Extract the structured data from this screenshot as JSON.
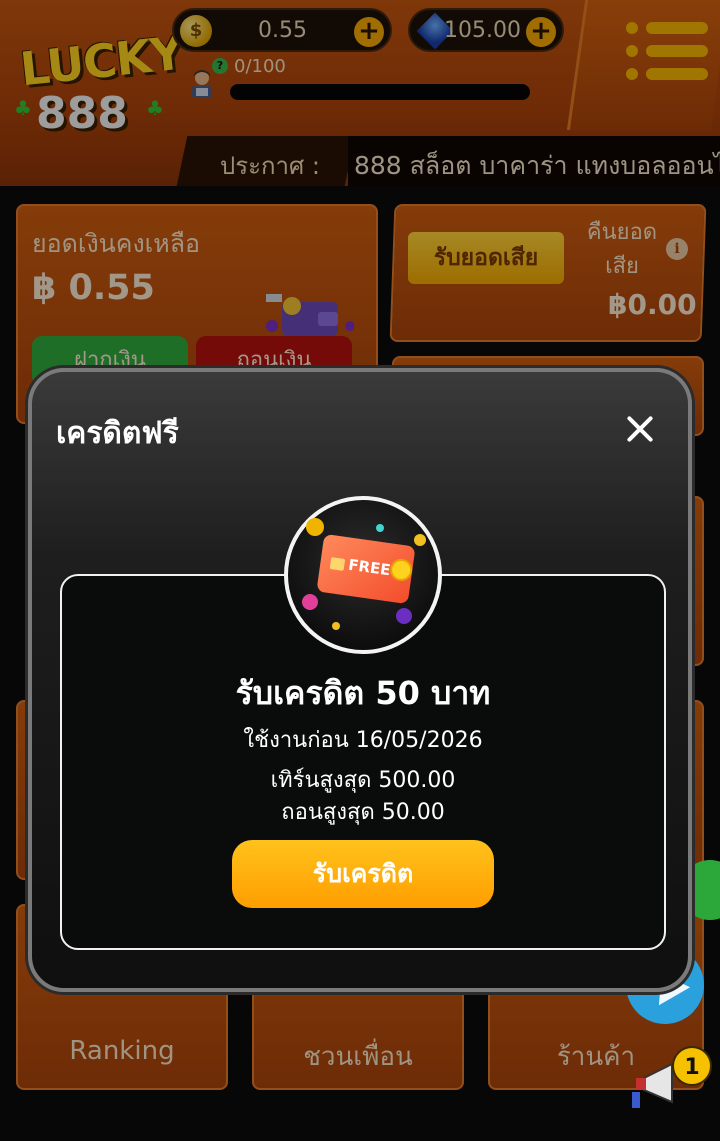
{
  "header": {
    "logo_text": "LUCKY 888",
    "coin_balance": "0.55",
    "gem_balance": "105.00",
    "xp_text": "0/100",
    "xp_progress": 0,
    "announcement_label": "ประกาศ :",
    "announcement_text": "888 สล็อต บาคาร่า แทงบอลออนไ"
  },
  "balance_card": {
    "title": "ยอดเงินคงเหลือ",
    "amount": "฿ 0.55",
    "deposit_label": "ฝากเงิน",
    "withdraw_label": "ถอนเงิน"
  },
  "refund_card": {
    "claim_loss_label": "รับยอดเสีย",
    "refund_label": "คืนยอดเสีย",
    "amount": "฿0.00"
  },
  "bottom_nav": {
    "ranking": "Ranking",
    "invite": "ชวนเพื่อน",
    "shop": "ร้านค้า"
  },
  "promo": {
    "badge_count": "1"
  },
  "modal": {
    "title": "เครดิตฟรี",
    "badge_text": "FREE",
    "reward_title": "รับเครดิต 50 บาท",
    "expiry": "ใช้งานก่อน 16/05/2026",
    "max_turnover": "เทิร์นสูงสุด 500.00",
    "max_withdraw": "ถอนสูงสุด 50.00",
    "claim_button": "รับเครดิต"
  },
  "colors": {
    "brand_orange": "#c4560f",
    "accent_yellow": "#f6a900",
    "claim_button": "#ffb20e",
    "deposit_green": "#2eaa3c",
    "withdraw_red": "#b3120e"
  },
  "icons": [
    "coin-icon",
    "gem-icon",
    "plus-icon",
    "menu-icon",
    "info-icon",
    "wallet-icon",
    "close-icon",
    "free-credit-card-icon",
    "telegram-icon",
    "megaphone-icon"
  ]
}
